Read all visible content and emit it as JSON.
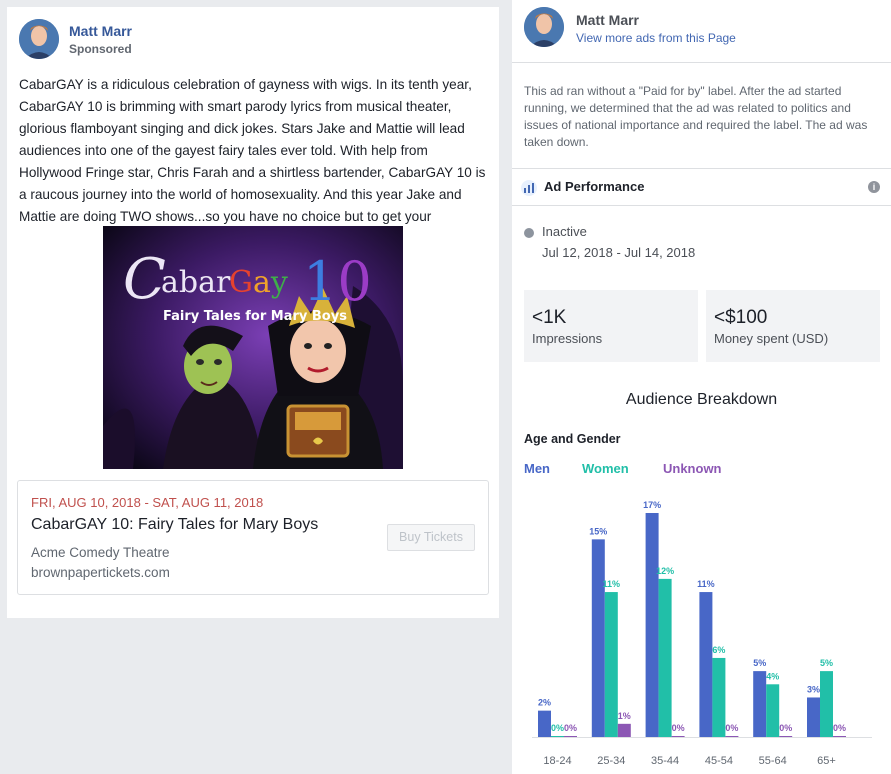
{
  "post": {
    "author": "Matt Marr",
    "sponsored_label": "Sponsored",
    "text": "CabarGAY is a ridiculous celebration of gayness with wigs. In its tenth year, CabarGAY 10 is brimming with smart parody lyrics from musical theater, glorious flamboyant singing and dick jokes. Stars Jake and Mattie will lead audiences into one of the gayest fairy tales ever told. With help from Hollywood Fringe star, Chris Farah and a shirtless bartender, CabarGAY 10 is a raucous journey into the world of homosexuality. And this year Jake and Mattie are doing TWO shows...so you have no choice but to get your",
    "image": {
      "logo_prefix": "CabarGay",
      "logo_number": "10",
      "subtitle": "Fairy Tales for Mary Boys"
    },
    "event": {
      "date": "FRI, AUG 10, 2018 - SAT, AUG 11, 2018",
      "title": "CabarGAY 10: Fairy Tales for Mary Boys",
      "venue": "Acme Comedy Theatre",
      "domain": "brownpapertickets.com",
      "button_label": "Buy Tickets"
    }
  },
  "panel": {
    "author": "Matt Marr",
    "view_more_link": "View more ads from this Page",
    "notice": "This ad ran without a \"Paid for by\" label. After the ad started running, we determined that the ad was related to politics and issues of national importance and required the label. The ad was taken down.",
    "performance": {
      "title": "Ad Performance",
      "status": "Inactive",
      "dates": "Jul 12, 2018 - Jul 14, 2018",
      "impressions_value": "<1K",
      "impressions_label": "Impressions",
      "spent_value": "<$100",
      "spent_label": "Money spent (USD)"
    },
    "audience_title": "Audience Breakdown",
    "age_gender_title": "Age and Gender",
    "colors": {
      "men": "#4867c7",
      "women": "#21bfa8",
      "unknown": "#8c57b4",
      "link": "#4267b2"
    }
  },
  "chart_data": {
    "type": "bar",
    "categories": [
      "18-24",
      "25-34",
      "35-44",
      "45-54",
      "55-64",
      "65+"
    ],
    "series": [
      {
        "name": "Men",
        "values": [
          2,
          15,
          17,
          11,
          5,
          3
        ],
        "labels": [
          "2%",
          "15%",
          "17%",
          "11%",
          "5%",
          "3%"
        ]
      },
      {
        "name": "Women",
        "values": [
          0,
          11,
          12,
          6,
          4,
          5
        ],
        "labels": [
          "0%",
          "11%",
          "12%",
          "6%",
          "4%",
          "5%"
        ]
      },
      {
        "name": "Unknown",
        "values": [
          0,
          1,
          0,
          0,
          0,
          0
        ],
        "labels": [
          "0%",
          "1%",
          "0%",
          "0%",
          "0%",
          "0%"
        ]
      }
    ],
    "title": "",
    "xlabel": "",
    "ylabel": "",
    "ylim": [
      0,
      17
    ],
    "grid": false,
    "legend": "top-left"
  }
}
